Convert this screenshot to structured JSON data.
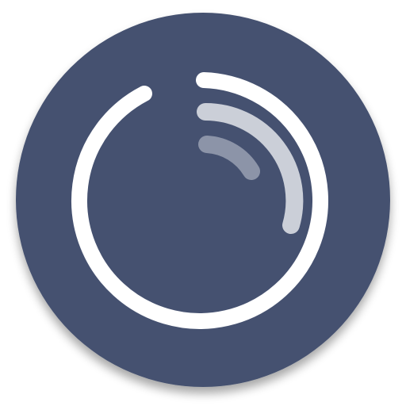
{
  "icon": {
    "name": "app-icon",
    "description_icon": "progress-ring-icon",
    "colors": {
      "background_disc": "#45516F",
      "ring": "#FFFFFF",
      "arc_outer": "#FFFFFF",
      "arc_middle": "#CBCFD8",
      "arc_inner": "#8C94A8"
    }
  }
}
